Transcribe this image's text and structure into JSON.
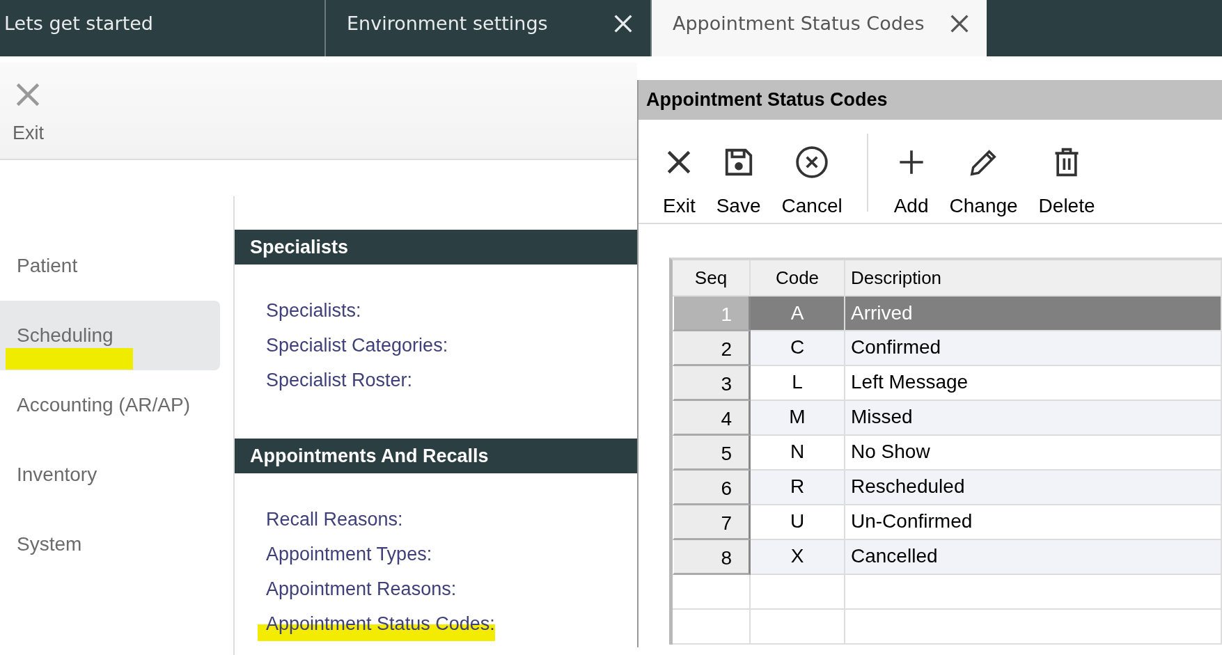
{
  "tabs": [
    {
      "label": "Lets get started",
      "closable": false,
      "selected": false
    },
    {
      "label": "Environment settings",
      "closable": true,
      "selected": false
    },
    {
      "label": "Appointment Status Codes",
      "closable": true,
      "selected": true
    }
  ],
  "exit_button": {
    "label": "Exit"
  },
  "sidebar": {
    "items": [
      {
        "label": "Patient",
        "selected": false,
        "highlighted": false
      },
      {
        "label": "Scheduling",
        "selected": true,
        "highlighted": true
      },
      {
        "label": "Accounting (AR/AP)",
        "selected": false,
        "highlighted": false
      },
      {
        "label": "Inventory",
        "selected": false,
        "highlighted": false
      },
      {
        "label": "System",
        "selected": false,
        "highlighted": false
      }
    ]
  },
  "sections": [
    {
      "title": "Specialists",
      "links": [
        {
          "label": "Specialists:",
          "highlighted": false
        },
        {
          "label": "Specialist Categories:",
          "highlighted": false
        },
        {
          "label": "Specialist Roster:",
          "highlighted": false
        }
      ]
    },
    {
      "title": "Appointments And Recalls",
      "links": [
        {
          "label": "Recall Reasons:",
          "highlighted": false
        },
        {
          "label": "Appointment Types:",
          "highlighted": false
        },
        {
          "label": "Appointment Reasons:",
          "highlighted": false
        },
        {
          "label": "Appointment Status Codes:",
          "highlighted": true
        }
      ]
    }
  ],
  "dialog": {
    "title": "Appointment Status Codes",
    "toolbar": [
      {
        "kind": "exit",
        "label": "Exit",
        "separator_before": false
      },
      {
        "kind": "save",
        "label": "Save",
        "separator_before": false
      },
      {
        "kind": "cancel",
        "label": "Cancel",
        "separator_before": false
      },
      {
        "kind": "add",
        "label": "Add",
        "separator_before": true
      },
      {
        "kind": "change",
        "label": "Change",
        "separator_before": false
      },
      {
        "kind": "delete",
        "label": "Delete",
        "separator_before": false
      }
    ],
    "table": {
      "columns": [
        "Seq",
        "Code",
        "Description"
      ],
      "rows": [
        {
          "seq": "1",
          "code": "A",
          "description": "Arrived",
          "selected": true
        },
        {
          "seq": "2",
          "code": "C",
          "description": "Confirmed",
          "selected": false
        },
        {
          "seq": "3",
          "code": "L",
          "description": "Left Message",
          "selected": false
        },
        {
          "seq": "4",
          "code": "M",
          "description": "Missed",
          "selected": false
        },
        {
          "seq": "5",
          "code": "N",
          "description": "No Show",
          "selected": false
        },
        {
          "seq": "6",
          "code": "R",
          "description": "Rescheduled",
          "selected": false
        },
        {
          "seq": "7",
          "code": "U",
          "description": "Un-Confirmed",
          "selected": false
        },
        {
          "seq": "8",
          "code": "X",
          "description": "Cancelled",
          "selected": false
        }
      ]
    }
  }
}
